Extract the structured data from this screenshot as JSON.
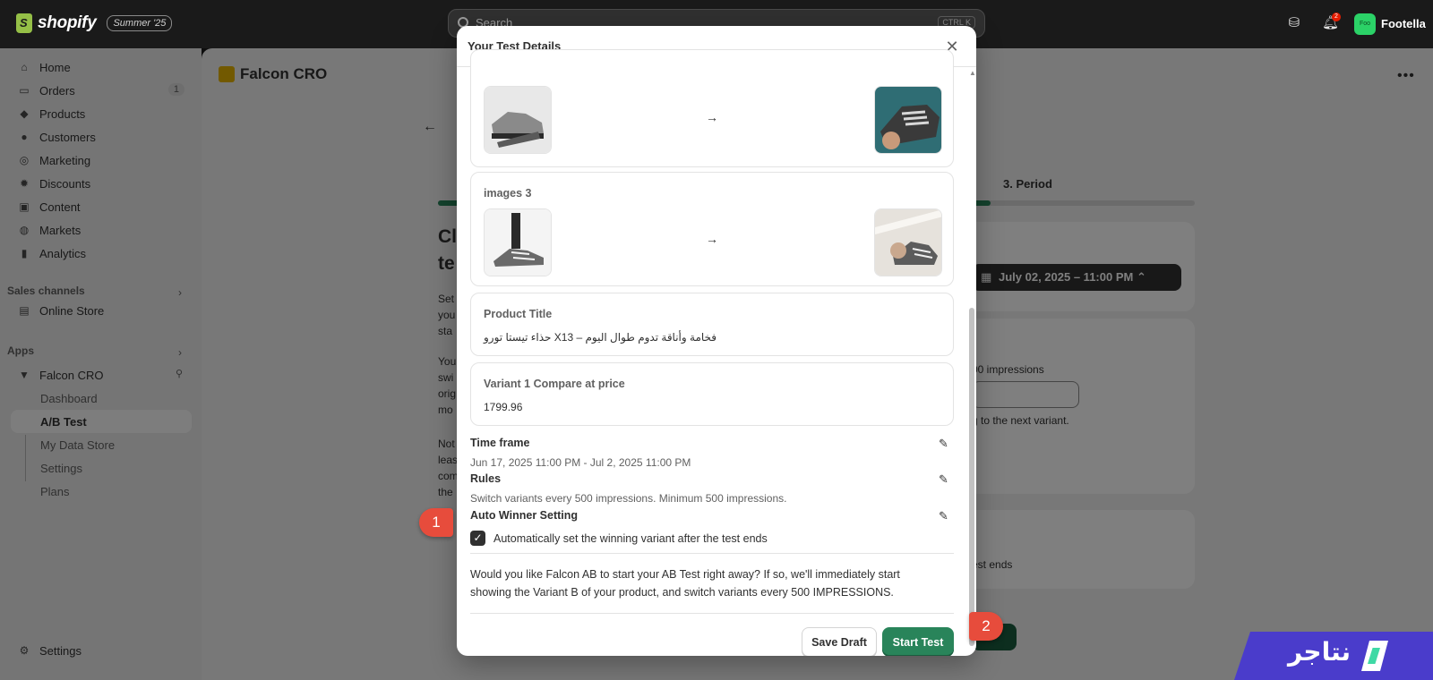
{
  "topbar": {
    "logo_text": "shopify",
    "edition_badge": "Summer '25",
    "search_placeholder": "Search",
    "search_shortcut": "CTRL K",
    "notifications_count": "2",
    "store_initials": "Foo",
    "store_name": "Footella"
  },
  "sidebar": {
    "main": [
      {
        "label": "Home",
        "icon": "home-icon"
      },
      {
        "label": "Orders",
        "icon": "inbox-icon",
        "count": "1"
      },
      {
        "label": "Products",
        "icon": "tag-icon"
      },
      {
        "label": "Customers",
        "icon": "person-icon"
      },
      {
        "label": "Marketing",
        "icon": "target-icon"
      },
      {
        "label": "Discounts",
        "icon": "discount-icon"
      },
      {
        "label": "Content",
        "icon": "content-icon"
      },
      {
        "label": "Markets",
        "icon": "globe-icon"
      },
      {
        "label": "Analytics",
        "icon": "bar-chart-icon"
      }
    ],
    "sales_channels_label": "Sales channels",
    "online_store": "Online Store",
    "apps_label": "Apps",
    "app_name": "Falcon CRO",
    "app_subitems": [
      "Dashboard",
      "A/B Test",
      "My Data Store",
      "Settings",
      "Plans"
    ],
    "active_subitem": "A/B Test",
    "settings": "Settings"
  },
  "page": {
    "app_title": "Falcon CRO",
    "heading_line1": "Cl",
    "heading_line2": "te",
    "para1": [
      "Set",
      "you",
      "sta"
    ],
    "para2": [
      "You",
      "swi",
      "orig",
      "mo"
    ],
    "para3": [
      "Not",
      "leas",
      "com",
      "the"
    ],
    "step_label": "3. Period",
    "progress_fraction": 0.73,
    "date_button": "July 02, 2025 – 11:00 PM",
    "impressions_fragment": "00 impressions",
    "next_variant_fragment": "g to the next variant.",
    "test_ends_fragment": "est ends"
  },
  "modal": {
    "title": "Your Test Details",
    "images3_label": "images 3",
    "product_title_label": "Product Title",
    "product_title_value": "فخامة وأناقة تدوم طوال اليوم – X13 حذاء تيستا تورو",
    "compare_price_label": "Variant 1 Compare at price",
    "compare_price_value": "1799.96",
    "timeframe_label": "Time frame",
    "timeframe_value": "Jun 17, 2025 11:00 PM - Jul 2, 2025 11:00 PM",
    "rules_label": "Rules",
    "rules_value": "Switch variants every 500 impressions. Minimum 500 impressions.",
    "auto_winner_label": "Auto Winner Setting",
    "auto_winner_checkbox": "Automatically set the winning variant after the test ends",
    "auto_winner_checked": true,
    "confirm_line1": "Would you like Falcon AB to start your AB Test right away? If so, we'll immediately start",
    "confirm_line2": "showing the Variant B of your product, and switch variants every 500 IMPRESSIONS.",
    "save_draft": "Save Draft",
    "start_test": "Start Test"
  },
  "annotations": {
    "marker1": "1",
    "marker2": "2"
  },
  "brand": {
    "text": "نتاجر"
  },
  "colors": {
    "primary_green": "#29845a",
    "topbar": "#1a1a1a",
    "marker_red": "#e74c3c",
    "brand_purple": "#4a3ccb"
  }
}
